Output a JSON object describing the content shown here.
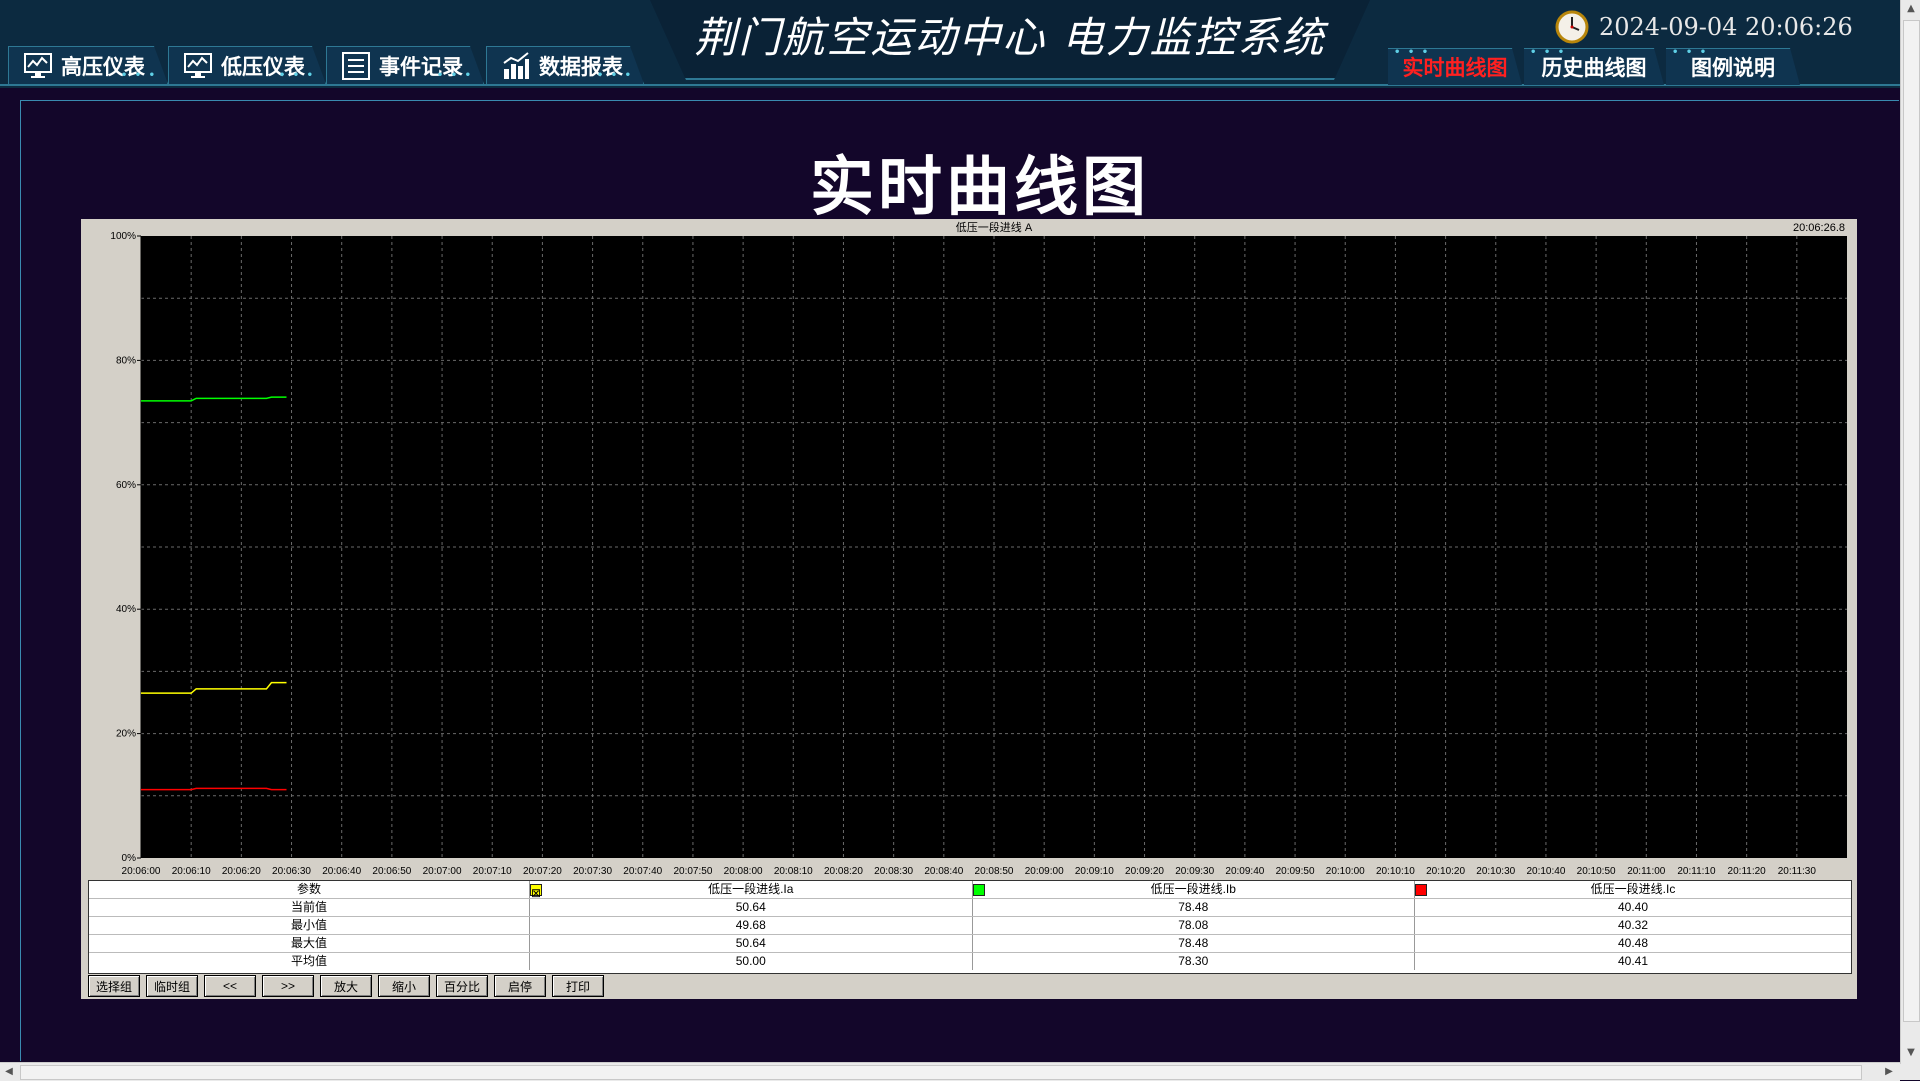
{
  "app": {
    "title": "荆门航空运动中心  电力监控系统",
    "datetime": "2024-09-04 20:06:26"
  },
  "nav_left": [
    {
      "label": "高压仪表",
      "icon": "monitor-chart-icon"
    },
    {
      "label": "低压仪表",
      "icon": "monitor-chart-icon"
    },
    {
      "label": "事件记录",
      "icon": "list-icon"
    },
    {
      "label": "数据报表",
      "icon": "bar-chart-icon"
    }
  ],
  "nav_right": [
    {
      "label": "实时曲线图",
      "active": true
    },
    {
      "label": "历史曲线图",
      "active": false
    },
    {
      "label": "图例说明",
      "active": false
    }
  ],
  "page": {
    "title": "实时曲线图"
  },
  "chart_data": {
    "type": "line",
    "title": "低压一段进线  A",
    "timestamp": "20:06:26.8",
    "ylim": [
      0,
      100
    ],
    "y_ticks": [
      "0%",
      "20%",
      "40%",
      "60%",
      "80%",
      "100%"
    ],
    "x_ticks": [
      "20:06:00",
      "20:06:10",
      "20:06:20",
      "20:06:30",
      "20:06:40",
      "20:06:50",
      "20:07:00",
      "20:07:10",
      "20:07:20",
      "20:07:30",
      "20:07:40",
      "20:07:50",
      "20:08:00",
      "20:08:10",
      "20:08:20",
      "20:08:30",
      "20:08:40",
      "20:08:50",
      "20:09:00",
      "20:09:10",
      "20:09:20",
      "20:09:30",
      "20:09:40",
      "20:09:50",
      "20:10:00",
      "20:10:10",
      "20:10:20",
      "20:10:30",
      "20:10:40",
      "20:10:50",
      "20:11:00",
      "20:11:10",
      "20:11:20",
      "20:11:30"
    ],
    "x_range": [
      "20:06:00",
      "20:11:40"
    ],
    "grid": true,
    "series": [
      {
        "name": "低压一段进线.Ia",
        "color": "#ffff00",
        "points": [
          [
            "20:06:00",
            26.5
          ],
          [
            "20:06:10",
            26.5
          ],
          [
            "20:06:11",
            27.2
          ],
          [
            "20:06:25",
            27.2
          ],
          [
            "20:06:26",
            28.2
          ],
          [
            "20:06:29",
            28.2
          ]
        ]
      },
      {
        "name": "低压一段进线.Ib",
        "color": "#00ff00",
        "points": [
          [
            "20:06:00",
            73.5
          ],
          [
            "20:06:10",
            73.5
          ],
          [
            "20:06:11",
            73.9
          ],
          [
            "20:06:25",
            73.9
          ],
          [
            "20:06:26",
            74.1
          ],
          [
            "20:06:29",
            74.1
          ]
        ]
      },
      {
        "name": "低压一段进线.Ic",
        "color": "#ff0000",
        "points": [
          [
            "20:06:00",
            11.0
          ],
          [
            "20:06:10",
            11.0
          ],
          [
            "20:06:11",
            11.2
          ],
          [
            "20:06:25",
            11.2
          ],
          [
            "20:06:26",
            11.0
          ],
          [
            "20:06:29",
            11.0
          ]
        ]
      }
    ]
  },
  "stats": {
    "header_label": "参数",
    "columns": [
      {
        "name": "低压一段进线.Ia",
        "color": "#ffff00"
      },
      {
        "name": "低压一段进线.Ib",
        "color": "#00ff00"
      },
      {
        "name": "低压一段进线.Ic",
        "color": "#ff0000"
      }
    ],
    "rows": [
      {
        "label": "当前值",
        "values": [
          "50.64",
          "78.48",
          "40.40"
        ]
      },
      {
        "label": "最小值",
        "values": [
          "49.68",
          "78.08",
          "40.32"
        ]
      },
      {
        "label": "最大值",
        "values": [
          "50.64",
          "78.48",
          "40.48"
        ]
      },
      {
        "label": "平均值",
        "values": [
          "50.00",
          "78.30",
          "40.41"
        ]
      }
    ]
  },
  "toolbar": [
    "选择组",
    "临时组",
    "<<",
    ">>",
    "放大",
    "缩小",
    "百分比",
    "启停",
    "打印"
  ]
}
